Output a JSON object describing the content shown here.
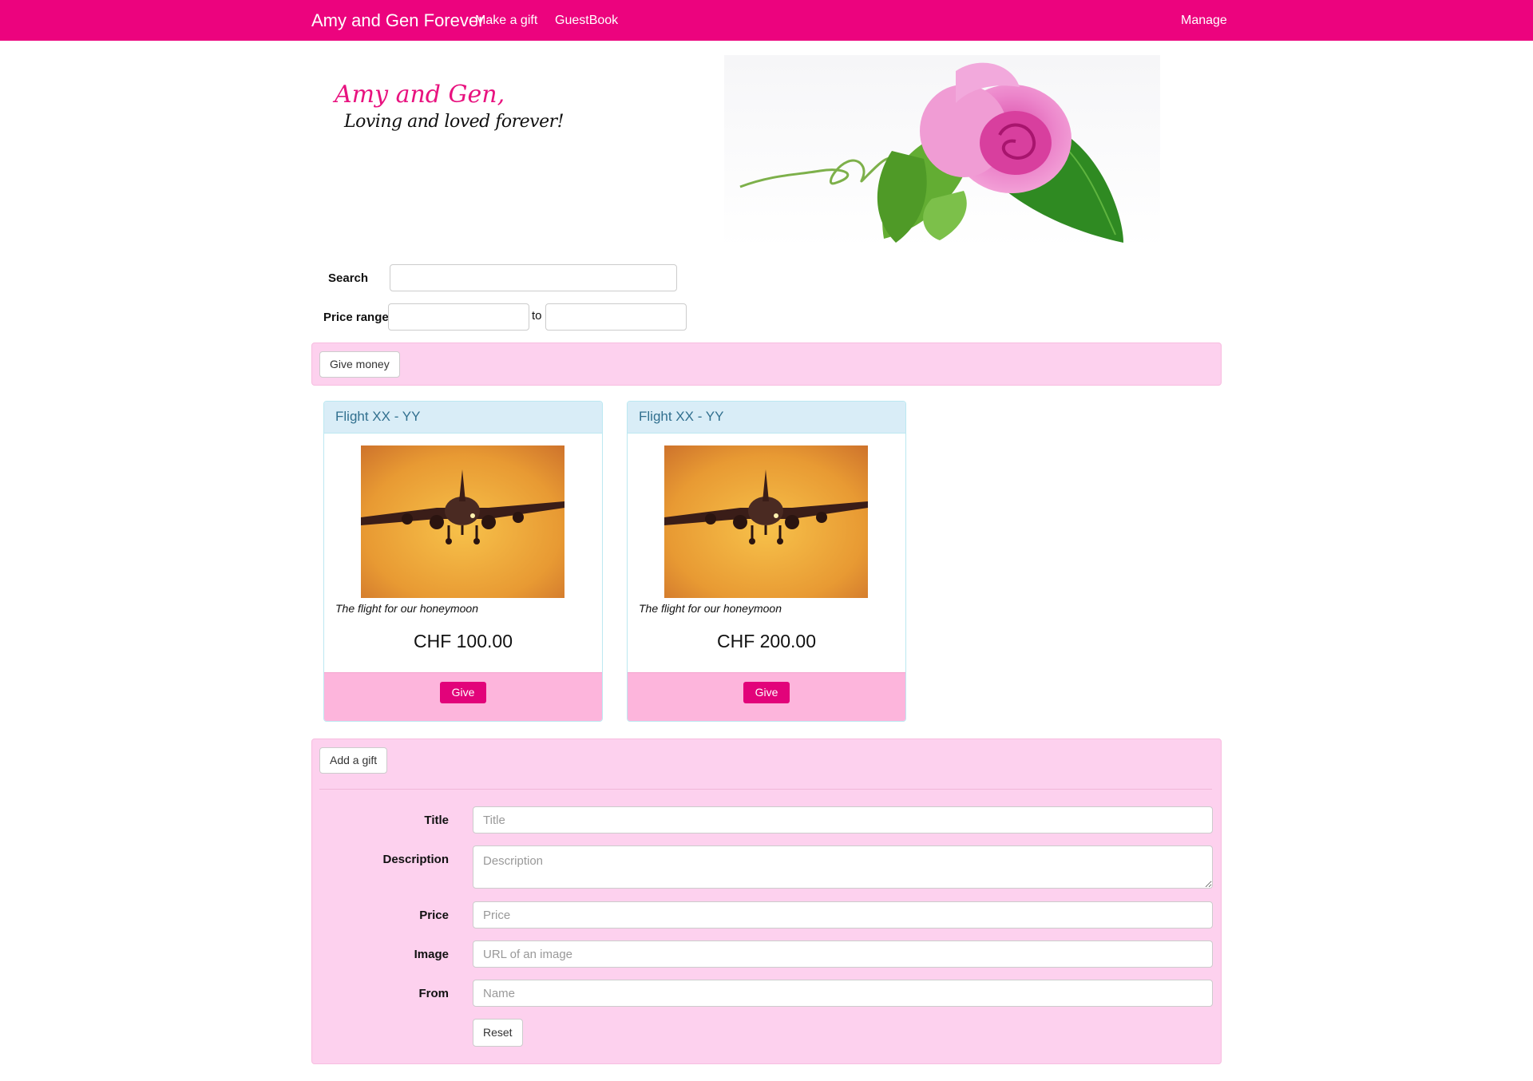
{
  "navbar": {
    "brand": "Amy and Gen Forever",
    "links": [
      "Make a gift",
      "GuestBook"
    ],
    "right_link": "Manage",
    "color": "#ec037e"
  },
  "hero": {
    "title": "Amy and Gen,",
    "subtitle": "Loving and loved forever!",
    "image": "rose-icon"
  },
  "filters": {
    "search_label": "Search",
    "search_value": "",
    "price_label": "Price range",
    "price_from": "",
    "to_label": "to",
    "price_to": ""
  },
  "money": {
    "button": "Give money"
  },
  "gifts": [
    {
      "title": "Flight XX - YY",
      "image": "airplane-icon",
      "description": "The flight for our honeymoon",
      "price": "CHF 100.00",
      "button": "Give"
    },
    {
      "title": "Flight XX - YY",
      "image": "airplane-icon",
      "description": "The flight for our honeymoon",
      "price": "CHF 200.00",
      "button": "Give"
    }
  ],
  "add_gift": {
    "button": "Add a gift",
    "fields": {
      "title": {
        "label": "Title",
        "placeholder": "Title"
      },
      "description": {
        "label": "Description",
        "placeholder": "Description"
      },
      "price": {
        "label": "Price",
        "placeholder": "Price"
      },
      "image": {
        "label": "Image",
        "placeholder": "URL of an image"
      },
      "from": {
        "label": "From",
        "placeholder": "Name"
      }
    },
    "reset": "Reset"
  },
  "colors": {
    "accent": "#e2037a",
    "well": "#fdd1ee",
    "card_header": "#d9edf7",
    "card_title": "#31708f"
  }
}
